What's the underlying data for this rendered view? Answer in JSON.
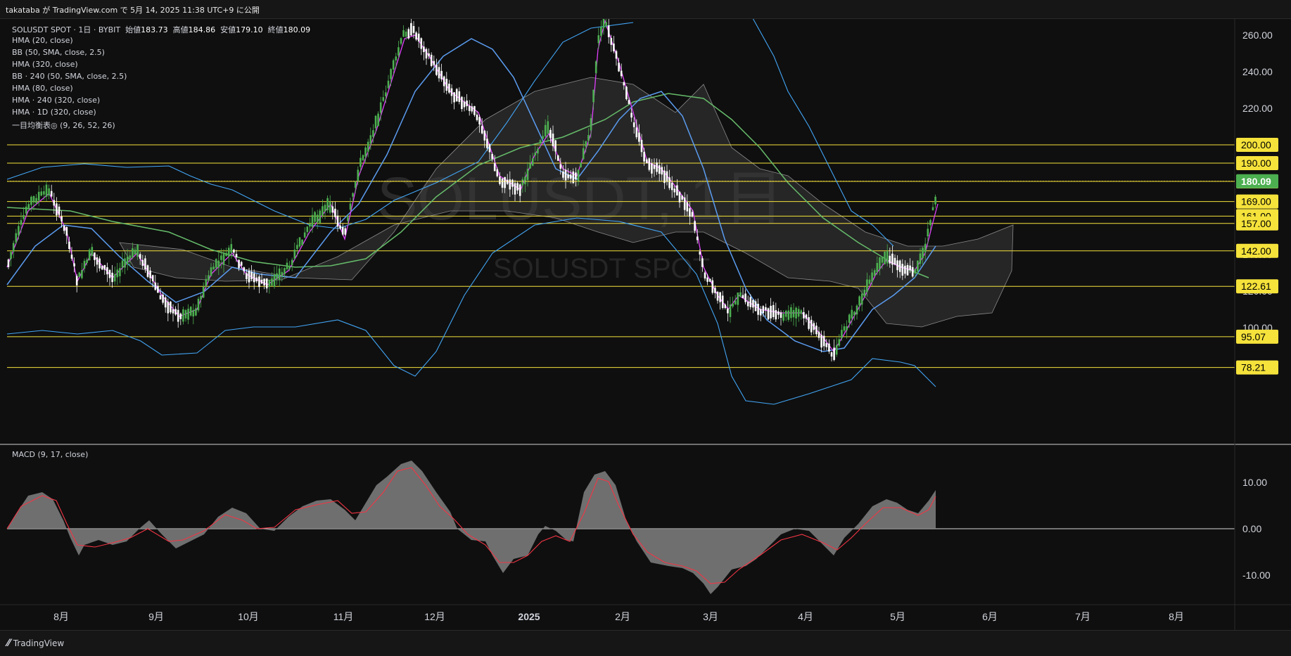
{
  "header": {
    "publish_text": "takataba が TradingView.com で 5月 14, 2025 11:38 UTC+9 に公開"
  },
  "legend": {
    "symbol_line_prefix": "SOLUSDT SPOT · 1日 · BYBIT",
    "open_label": "始値",
    "open_value": "183.73",
    "high_label": "高値",
    "high_value": "184.86",
    "low_label": "安値",
    "low_value": "179.10",
    "close_label": "終値",
    "close_value": "180.09",
    "indicators": [
      "HMA (20, close)",
      "BB (50, SMA, close, 2.5)",
      "HMA (320, close)",
      "BB · 240 (50, SMA, close, 2.5)",
      "HMA (80, close)",
      "HMA · 240 (320, close)",
      "HMA · 1D (320, close)",
      "一目均衡表◎ (9, 26, 52, 26)"
    ],
    "macd_label": "MACD (9, 17, close)"
  },
  "watermark": {
    "main": "SOLUSDT, 1日",
    "sub": "SOLUSDT SPOT"
  },
  "footer": {
    "brand": "TradingView"
  },
  "colors": {
    "up": "#4caf50",
    "down": "#ffffff",
    "hma_fast": "#e040fb",
    "hma_slow": "#4caf50",
    "bb": "#42a5f5",
    "hline": "#f5e23b",
    "price_badge": "#4caf50",
    "macd_signal": "#f23645",
    "macd_area": "#808080"
  },
  "chart_data": [
    {
      "type": "candlestick",
      "title": "SOLUSDT SPOT · 1日 · BYBIT",
      "yaxis_ticks": [
        "100.00",
        "120.00",
        "140.00",
        "160.00",
        "180.00",
        "200.00",
        "220.00",
        "240.00",
        "260.00"
      ],
      "ylim": [
        70,
        265
      ],
      "xaxis_ticks": [
        "8月",
        "9月",
        "10月",
        "11月",
        "12月",
        "2025",
        "1月",
        "2月",
        "3月",
        "4月",
        "5月",
        "6月",
        "7月",
        "8月"
      ],
      "current_price": "180.09",
      "horizontal_levels": [
        "200.00",
        "190.00",
        "180.00",
        "169.00",
        "161.00",
        "157.00",
        "142.00",
        "122.61",
        "95.07",
        "78.21"
      ],
      "close_series": [
        {
          "month": "2024-07",
          "close": 160
        },
        {
          "month": "2024-08",
          "close": 145
        },
        {
          "month": "2024-09",
          "close": 152
        },
        {
          "month": "2024-10",
          "close": 170
        },
        {
          "month": "2024-11",
          "close": 240
        },
        {
          "month": "2024-12",
          "close": 190
        },
        {
          "month": "2025-01",
          "close": 235
        },
        {
          "month": "2025-02",
          "close": 145
        },
        {
          "month": "2025-03",
          "close": 125
        },
        {
          "month": "2025-04",
          "close": 145
        },
        {
          "month": "2025-05",
          "close": 180.09
        }
      ]
    },
    {
      "type": "area",
      "title": "MACD (9, 17, close)",
      "yaxis_ticks": [
        "10.00",
        "0.00",
        "-10.00"
      ],
      "ylim": [
        -14,
        17
      ]
    }
  ]
}
